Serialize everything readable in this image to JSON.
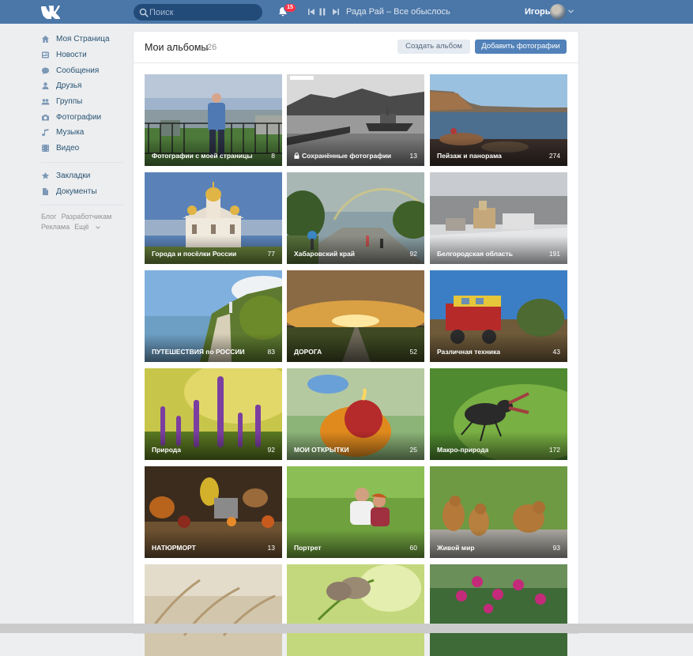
{
  "topbar": {
    "search_placeholder": "Поиск",
    "notifications_count": "15",
    "track": "Рада Рай – Все обыслось",
    "user_name": "Игорь"
  },
  "nav": {
    "items": [
      {
        "label": "Моя Страница",
        "icon": "home-icon"
      },
      {
        "label": "Новости",
        "icon": "news-icon"
      },
      {
        "label": "Сообщения",
        "icon": "messages-icon"
      },
      {
        "label": "Друзья",
        "icon": "friends-icon"
      },
      {
        "label": "Группы",
        "icon": "groups-icon"
      },
      {
        "label": "Фотографии",
        "icon": "camera-icon"
      },
      {
        "label": "Музыка",
        "icon": "music-icon"
      },
      {
        "label": "Видео",
        "icon": "video-icon"
      }
    ],
    "items2": [
      {
        "label": "Закладки",
        "icon": "star-icon"
      },
      {
        "label": "Документы",
        "icon": "document-icon"
      }
    ],
    "footer": [
      "Блог",
      "Разработчикам",
      "Реклама",
      "Ещё"
    ]
  },
  "page": {
    "title": "Мои альбомы",
    "count": "26",
    "create_label": "Создать альбом",
    "add_label": "Добавить фотографии"
  },
  "albums": [
    {
      "name": "Фотографии с моей страницы",
      "count": "8"
    },
    {
      "name": "Сохранённые фотографии",
      "count": "13",
      "locked": true
    },
    {
      "name": "Пейзаж и панорама",
      "count": "274"
    },
    {
      "name": "Города и посёлки России",
      "count": "77"
    },
    {
      "name": "Хабаровский край",
      "count": "92"
    },
    {
      "name": "Белгородская область",
      "count": "191"
    },
    {
      "name": "ПУТЕШЕСТВИЯ по РОССИИ",
      "count": "83"
    },
    {
      "name": "ДОРОГА",
      "count": "52"
    },
    {
      "name": "Различная техника",
      "count": "43"
    },
    {
      "name": "Природа",
      "count": "92"
    },
    {
      "name": "МОИ ОТКРЫТКИ",
      "count": "25"
    },
    {
      "name": "Макро-природа",
      "count": "172"
    },
    {
      "name": "НАТЮРМОРТ",
      "count": "13"
    },
    {
      "name": "Портрет",
      "count": "60"
    },
    {
      "name": "Живой мир",
      "count": "93"
    },
    {
      "name": "",
      "count": ""
    },
    {
      "name": "",
      "count": ""
    },
    {
      "name": "",
      "count": ""
    }
  ],
  "colors": {
    "header": "#4a76a8",
    "accent": "#5181b8",
    "background": "#edeef0"
  }
}
